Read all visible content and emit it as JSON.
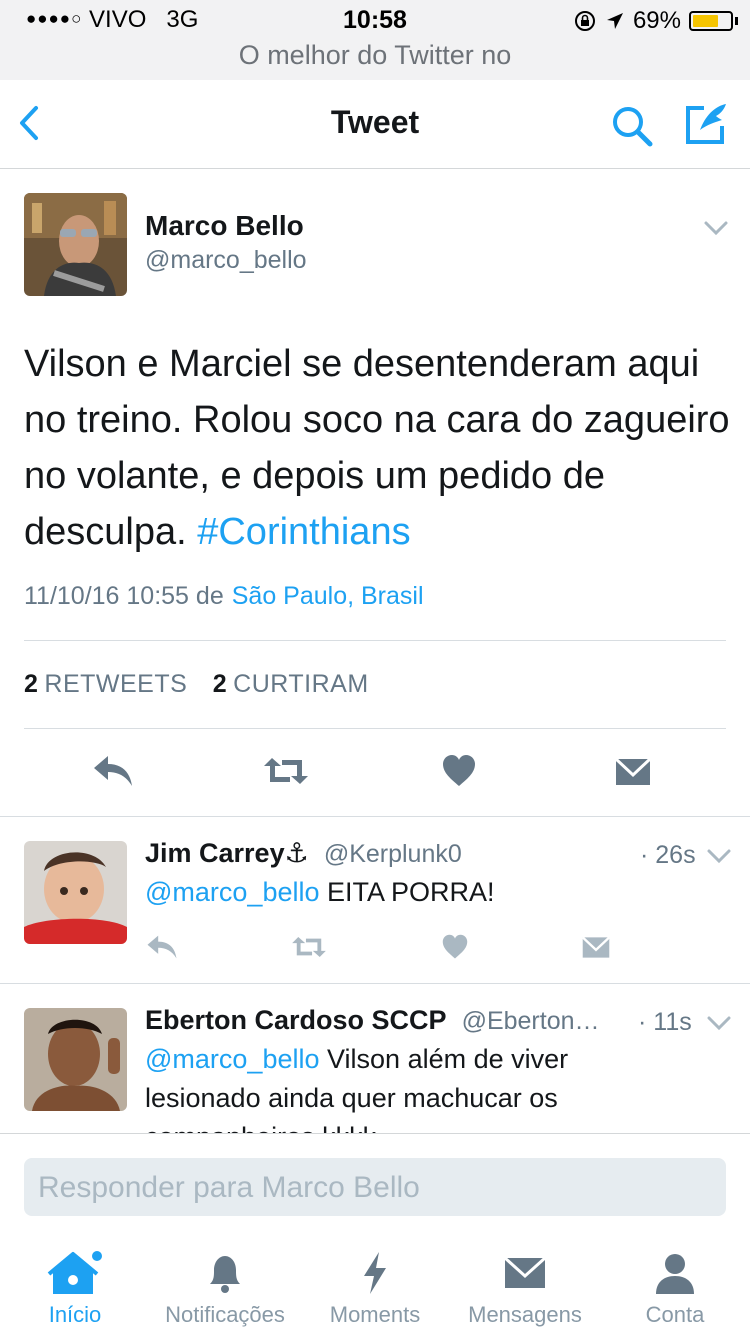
{
  "status_bar": {
    "signal": "●●●●○",
    "carrier": "VIVO",
    "network": "3G",
    "time": "10:58",
    "battery": "69%",
    "battery_level": 0.69,
    "subtitle": "O melhor do Twitter no"
  },
  "navbar": {
    "title": "Tweet"
  },
  "tweet": {
    "name": "Marco Bello",
    "handle": "@marco_bello",
    "text": "Vilson e Marciel se desentenderam aqui no treino. Rolou soco na cara do zagueiro no volante, e depois um pedido de desculpa.",
    "hashtag": "#Corinthians",
    "timestamp": "11/10/16 10:55 de",
    "location": "São Paulo, Brasil",
    "retweets_count": "2",
    "retweets_label": "RETWEETS",
    "likes_count": "2",
    "likes_label": "CURTIRAM"
  },
  "replies": [
    {
      "name": "Jim Carrey⚓",
      "handle": "@Kerplunk0",
      "time": "· 26s",
      "mention": "@marco_bello",
      "text": "EITA PORRA!"
    },
    {
      "name": "Eberton Cardoso SCCP",
      "handle": "@Eberton…",
      "time": "· 11s",
      "mention": "@marco_bello",
      "text_line1": "Vilson além de viver",
      "text_line2": "lesionado ainda quer machucar os",
      "text_line3": "companheiros kkkk"
    }
  ],
  "composer": {
    "placeholder": "Responder para Marco Bello"
  },
  "tabbar": [
    {
      "label": "Início",
      "active": true
    },
    {
      "label": "Notificações"
    },
    {
      "label": "Moments"
    },
    {
      "label": "Mensagens"
    },
    {
      "label": "Conta"
    }
  ],
  "colors": {
    "accent": "#1da1f2",
    "icon_gray": "#657786",
    "text": "#14171a"
  }
}
